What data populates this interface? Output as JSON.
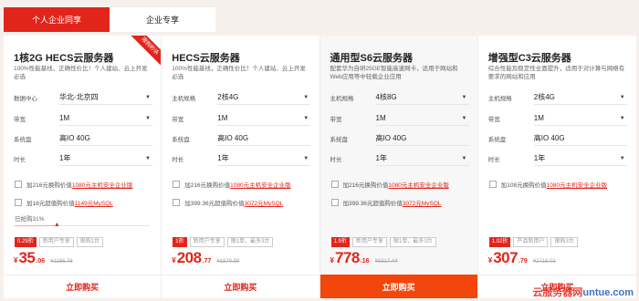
{
  "tabs": [
    {
      "label": "个人企业同享",
      "active": true
    },
    {
      "label": "企业专享",
      "active": false
    }
  ],
  "cards": [
    {
      "title": "1核2G HECS云服务器",
      "desc": "100%性能基线，正确性价比！个人建站、云上开发必选",
      "badge": "限购秒杀",
      "rows": [
        {
          "label": "数据中心",
          "value": "华北-北京四"
        },
        {
          "label": "带宽",
          "value": "1M"
        },
        {
          "label": "系统盘",
          "value": "高IO 40G"
        },
        {
          "label": "时长",
          "value": "1年"
        }
      ],
      "checks": [
        {
          "pre": "加216元换购价值",
          "red": "1080元主机安全企业版",
          "post": ""
        },
        {
          "pre": "加18元超值购价值",
          "red": "1149元MySQL",
          "post": ""
        }
      ],
      "progress_label": "已抢购31%",
      "progress": 0.31,
      "tags": [
        "0.29折",
        "新用户专享",
        "限购1台"
      ],
      "currency": "¥",
      "price_int": "35",
      "price_dec": ".06",
      "price_orig": "¥1186.76",
      "buy": "立即购买"
    },
    {
      "title": "HECS云服务器",
      "desc": "100%性能基线，正确性价比！个人建站、云上开发必选",
      "rows": [
        {
          "label": "主机规格",
          "value": "2核4G"
        },
        {
          "label": "带宽",
          "value": "1M"
        },
        {
          "label": "系统盘",
          "value": "高IO 40G"
        },
        {
          "label": "时长",
          "value": "1年"
        }
      ],
      "checks": [
        {
          "pre": "加216元换购价值",
          "red": "1080元主机安全企业版",
          "post": ""
        },
        {
          "pre": "加399.36元超值购价值",
          "red": "3072元MySQL",
          "post": ""
        }
      ],
      "tags": [
        "1折",
        "新用户专享",
        "限1单，最多3台"
      ],
      "currency": "¥",
      "price_int": "208",
      "price_dec": ".77",
      "price_orig": "¥1879.99",
      "buy": "立即购买"
    },
    {
      "title": "通用型S6云服务器",
      "desc": "配套华为自研25GE智能高速网卡，适用于网站和Web应用等中轻载企业应用",
      "rows": [
        {
          "label": "主机规格",
          "value": "4核8G"
        },
        {
          "label": "带宽",
          "value": "1M"
        },
        {
          "label": "系统盘",
          "value": "高IO 40G"
        },
        {
          "label": "时长",
          "value": "1年"
        }
      ],
      "checks": [
        {
          "pre": "加216元换购价值",
          "red": "1080元主机安全企业版",
          "post": ""
        },
        {
          "pre": "加399.36元超值购价值",
          "red": "3072元MySQL",
          "post": ""
        }
      ],
      "tags": [
        "1.9折",
        "新用户专享",
        "限1单，最多3台"
      ],
      "currency": "¥",
      "price_int": "778",
      "price_dec": ".16",
      "price_orig": "¥3317.44",
      "buy": "立即购买"
    },
    {
      "title": "增强型C3云服务器",
      "desc": "综合性能及稳定性全面提升，适用于对计算与网络有要求的网站和应用",
      "rows": [
        {
          "label": "主机规格",
          "value": "2核4G"
        },
        {
          "label": "带宽",
          "value": "1M"
        },
        {
          "label": "系统盘",
          "value": "高IO 40G"
        },
        {
          "label": "时长",
          "value": "1年"
        }
      ],
      "checks": [
        {
          "pre": "加108元换购价值",
          "red": "1080元主机安全企业版",
          "post": ""
        }
      ],
      "tags": [
        "1.02折",
        "产品新用户",
        "限购3台"
      ],
      "currency": "¥",
      "price_int": "307",
      "price_dec": ".79",
      "price_orig": "¥2715.01",
      "buy": "立即购买"
    }
  ],
  "watermark": {
    "left": "云服务器网",
    "right": "untue.com"
  },
  "colors": {
    "accent": "#e1251b",
    "buy_filled": "#f2460d",
    "background": "#f6f0ec"
  }
}
